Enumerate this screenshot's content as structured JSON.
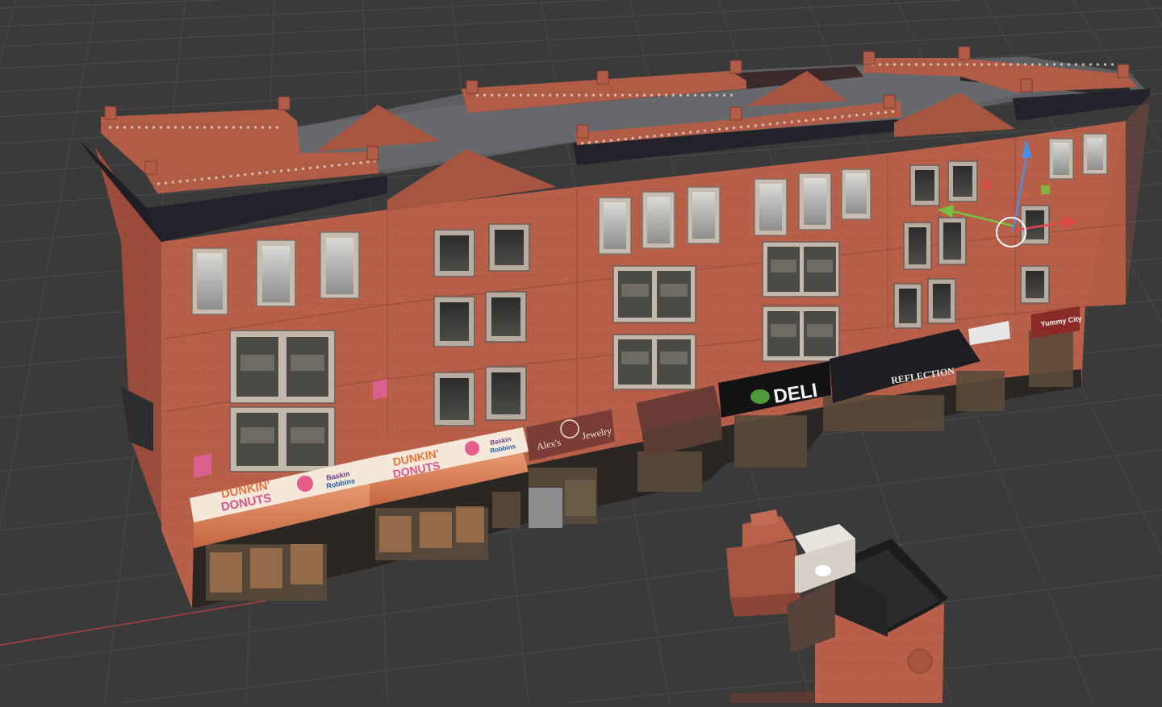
{
  "viewport": {
    "background": "#3a3a3a",
    "grid_color": "#4a4a4a",
    "x_axis_color": "#b34040"
  },
  "building": {
    "brick_color": "#b8604a",
    "cornice_color": "#2a2a30",
    "roof_color": "#5e5f63",
    "signs": {
      "dunkin_line1": "DUNKIN'",
      "dunkin_line2": "DONUTS",
      "baskin_line1": "Baskin",
      "baskin_line2": "Robbins",
      "alexs": "Alex's",
      "jewelry": "Jewelry",
      "deli": "DELI",
      "reflection": "REFLECTION",
      "yummy": "Yummy City"
    }
  },
  "gizmo": {
    "x_color": "#e04848",
    "y_color": "#7ac142",
    "z_color": "#4a8ee8",
    "icons": [
      "move-z-arrow-icon",
      "move-y-arrow-icon",
      "move-x-arrow-icon",
      "transform-center-icon"
    ]
  },
  "secondary_object": {
    "label": "chimney-fragment"
  }
}
